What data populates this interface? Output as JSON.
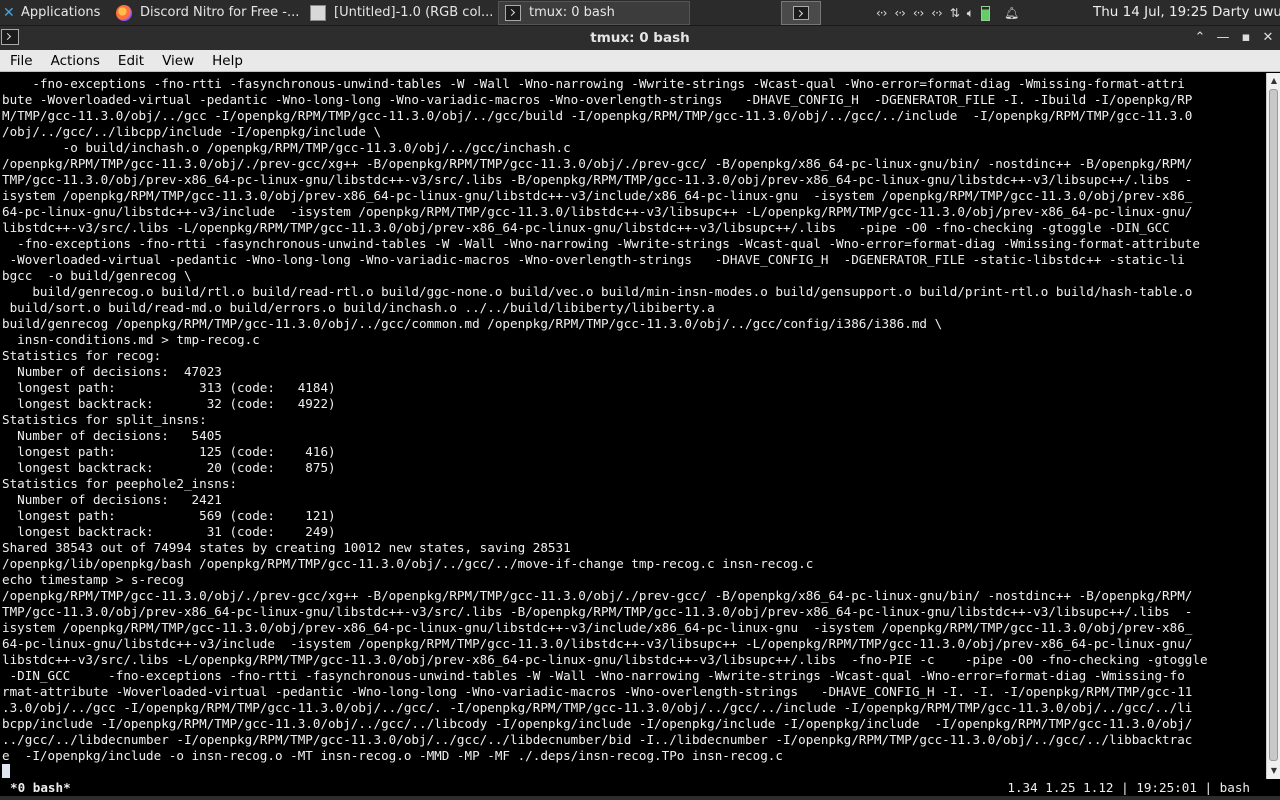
{
  "panel": {
    "apps_label": "Applications",
    "tasks": [
      {
        "label": "Discord Nitro for Free -...",
        "icon": "firefox-icon"
      },
      {
        "label": "[Untitled]-1.0 (RGB col...",
        "icon": "gimp-icon"
      },
      {
        "label": "tmux: 0 bash",
        "icon": "terminal-icon"
      }
    ],
    "clock": "Thu 14 Jul, 19:25",
    "user": "Darty uwu"
  },
  "window": {
    "title": "tmux: 0 bash"
  },
  "menu": [
    "File",
    "Actions",
    "Edit",
    "View",
    "Help"
  ],
  "terminal": {
    "lines": [
      "    -fno-exceptions -fno-rtti -fasynchronous-unwind-tables -W -Wall -Wno-narrowing -Wwrite-strings -Wcast-qual -Wno-error=format-diag -Wmissing-format-attri",
      "bute -Woverloaded-virtual -pedantic -Wno-long-long -Wno-variadic-macros -Wno-overlength-strings   -DHAVE_CONFIG_H  -DGENERATOR_FILE -I. -Ibuild -I/openpkg/RP",
      "M/TMP/gcc-11.3.0/obj/../gcc -I/openpkg/RPM/TMP/gcc-11.3.0/obj/../gcc/build -I/openpkg/RPM/TMP/gcc-11.3.0/obj/../gcc/../include  -I/openpkg/RPM/TMP/gcc-11.3.0",
      "/obj/../gcc/../libcpp/include -I/openpkg/include \\",
      "        -o build/inchash.o /openpkg/RPM/TMP/gcc-11.3.0/obj/../gcc/inchash.c",
      "/openpkg/RPM/TMP/gcc-11.3.0/obj/./prev-gcc/xg++ -B/openpkg/RPM/TMP/gcc-11.3.0/obj/./prev-gcc/ -B/openpkg/x86_64-pc-linux-gnu/bin/ -nostdinc++ -B/openpkg/RPM/",
      "TMP/gcc-11.3.0/obj/prev-x86_64-pc-linux-gnu/libstdc++-v3/src/.libs -B/openpkg/RPM/TMP/gcc-11.3.0/obj/prev-x86_64-pc-linux-gnu/libstdc++-v3/libsupc++/.libs  -",
      "isystem /openpkg/RPM/TMP/gcc-11.3.0/obj/prev-x86_64-pc-linux-gnu/libstdc++-v3/include/x86_64-pc-linux-gnu  -isystem /openpkg/RPM/TMP/gcc-11.3.0/obj/prev-x86_",
      "64-pc-linux-gnu/libstdc++-v3/include  -isystem /openpkg/RPM/TMP/gcc-11.3.0/libstdc++-v3/libsupc++ -L/openpkg/RPM/TMP/gcc-11.3.0/obj/prev-x86_64-pc-linux-gnu/",
      "libstdc++-v3/src/.libs -L/openpkg/RPM/TMP/gcc-11.3.0/obj/prev-x86_64-pc-linux-gnu/libstdc++-v3/libsupc++/.libs   -pipe -O0 -fno-checking -gtoggle -DIN_GCC",
      "  -fno-exceptions -fno-rtti -fasynchronous-unwind-tables -W -Wall -Wno-narrowing -Wwrite-strings -Wcast-qual -Wno-error=format-diag -Wmissing-format-attribute",
      " -Woverloaded-virtual -pedantic -Wno-long-long -Wno-variadic-macros -Wno-overlength-strings   -DHAVE_CONFIG_H  -DGENERATOR_FILE -static-libstdc++ -static-li",
      "bgcc  -o build/genrecog \\",
      "    build/genrecog.o build/rtl.o build/read-rtl.o build/ggc-none.o build/vec.o build/min-insn-modes.o build/gensupport.o build/print-rtl.o build/hash-table.o",
      " build/sort.o build/read-md.o build/errors.o build/inchash.o ../../build/libiberty/libiberty.a",
      "build/genrecog /openpkg/RPM/TMP/gcc-11.3.0/obj/../gcc/common.md /openpkg/RPM/TMP/gcc-11.3.0/obj/../gcc/config/i386/i386.md \\",
      "  insn-conditions.md > tmp-recog.c",
      "Statistics for recog:",
      "  Number of decisions:  47023",
      "  longest path:           313 (code:   4184)",
      "  longest backtrack:       32 (code:   4922)",
      "Statistics for split_insns:",
      "  Number of decisions:   5405",
      "  longest path:           125 (code:    416)",
      "  longest backtrack:       20 (code:    875)",
      "Statistics for peephole2_insns:",
      "  Number of decisions:   2421",
      "  longest path:           569 (code:    121)",
      "  longest backtrack:       31 (code:    249)",
      "Shared 38543 out of 74994 states by creating 10012 new states, saving 28531",
      "/openpkg/lib/openpkg/bash /openpkg/RPM/TMP/gcc-11.3.0/obj/../gcc/../move-if-change tmp-recog.c insn-recog.c",
      "echo timestamp > s-recog",
      "/openpkg/RPM/TMP/gcc-11.3.0/obj/./prev-gcc/xg++ -B/openpkg/RPM/TMP/gcc-11.3.0/obj/./prev-gcc/ -B/openpkg/x86_64-pc-linux-gnu/bin/ -nostdinc++ -B/openpkg/RPM/",
      "TMP/gcc-11.3.0/obj/prev-x86_64-pc-linux-gnu/libstdc++-v3/src/.libs -B/openpkg/RPM/TMP/gcc-11.3.0/obj/prev-x86_64-pc-linux-gnu/libstdc++-v3/libsupc++/.libs  -",
      "isystem /openpkg/RPM/TMP/gcc-11.3.0/obj/prev-x86_64-pc-linux-gnu/libstdc++-v3/include/x86_64-pc-linux-gnu  -isystem /openpkg/RPM/TMP/gcc-11.3.0/obj/prev-x86_",
      "64-pc-linux-gnu/libstdc++-v3/include  -isystem /openpkg/RPM/TMP/gcc-11.3.0/libstdc++-v3/libsupc++ -L/openpkg/RPM/TMP/gcc-11.3.0/obj/prev-x86_64-pc-linux-gnu/",
      "libstdc++-v3/src/.libs -L/openpkg/RPM/TMP/gcc-11.3.0/obj/prev-x86_64-pc-linux-gnu/libstdc++-v3/libsupc++/.libs  -fno-PIE -c    -pipe -O0 -fno-checking -gtoggle",
      " -DIN_GCC     -fno-exceptions -fno-rtti -fasynchronous-unwind-tables -W -Wall -Wno-narrowing -Wwrite-strings -Wcast-qual -Wno-error=format-diag -Wmissing-fo",
      "rmat-attribute -Woverloaded-virtual -pedantic -Wno-long-long -Wno-variadic-macros -Wno-overlength-strings   -DHAVE_CONFIG_H -I. -I. -I/openpkg/RPM/TMP/gcc-11",
      ".3.0/obj/../gcc -I/openpkg/RPM/TMP/gcc-11.3.0/obj/../gcc/. -I/openpkg/RPM/TMP/gcc-11.3.0/obj/../gcc/../include -I/openpkg/RPM/TMP/gcc-11.3.0/obj/../gcc/../li",
      "bcpp/include -I/openpkg/RPM/TMP/gcc-11.3.0/obj/../gcc/../libcody -I/openpkg/include -I/openpkg/include -I/openpkg/include  -I/openpkg/RPM/TMP/gcc-11.3.0/obj/",
      "../gcc/../libdecnumber -I/openpkg/RPM/TMP/gcc-11.3.0/obj/../gcc/../libdecnumber/bid -I../libdecnumber -I/openpkg/RPM/TMP/gcc-11.3.0/obj/../gcc/../libbacktrac",
      "e  -I/openpkg/include -o insn-recog.o -MT insn-recog.o -MMD -MP -MF ./.deps/insn-recog.TPo insn-recog.c"
    ]
  },
  "tmux": {
    "left": "*0 bash*",
    "right": "1.34 1.25 1.12 | 19:25:01 | bash"
  }
}
